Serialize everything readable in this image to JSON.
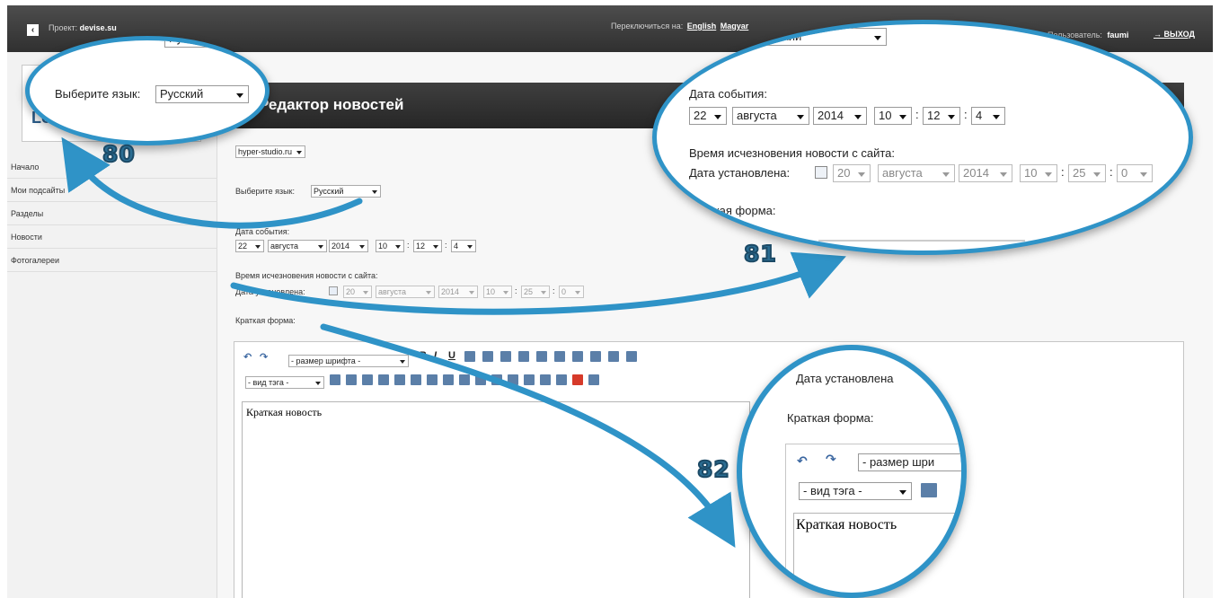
{
  "header": {
    "back_icon": "‹",
    "project_label": "Проект:",
    "project_name": "devise.su",
    "switch_label": "Переключиться на:",
    "lang_en": "English",
    "lang_hu": "Magyar",
    "user_label": "Пользователь:",
    "user_name": "faumi",
    "logout_icon": "→",
    "logout_label": "ВЫХОД"
  },
  "sidebar": {
    "items": [
      {
        "label": "Начало"
      },
      {
        "label": "Мои подсайты"
      },
      {
        "label": "Разделы"
      },
      {
        "label": "Новости"
      },
      {
        "label": "Фотогалереи"
      }
    ]
  },
  "main": {
    "title": "Редактор новостей",
    "site_select": "hyper-studio.ru",
    "language_label": "Выберите язык:",
    "language_value": "Русский",
    "event_date_label": "Дата события:",
    "event_date": {
      "day": "22",
      "month": "августа",
      "year": "2014",
      "hour": "10",
      "minute": "12",
      "second": "4"
    },
    "expire_label": "Время исчезновения новости с сайта:",
    "expire_set_label": "Дата установлена:",
    "expire_date": {
      "day": "20",
      "month": "августа",
      "year": "2014",
      "hour": "10",
      "minute": "25",
      "second": "0"
    },
    "short_form_label": "Краткая форма:",
    "editor": {
      "font_size_placeholder": "- размер шрифта -",
      "tag_type_placeholder": "- вид тэга -",
      "bold": "B",
      "italic": "I",
      "underline": "U",
      "content": "Краткая новость"
    }
  },
  "callouts": {
    "z80": {
      "label": "Выберите язык:",
      "value": "Русский",
      "top_value": "Русский"
    },
    "z81": {
      "top_select": "Русский",
      "event_label": "Дата события:",
      "event_date": {
        "day": "22",
        "month": "августа",
        "year": "2014",
        "hour": "10",
        "minute": "12",
        "second": "4"
      },
      "expire_label": "Время исчезновения новости с сайта:",
      "set_label": "Дата установлена:",
      "expire_date": {
        "day": "20",
        "month": "августа",
        "year": "2014",
        "hour": "10",
        "minute": "25",
        "second": "0"
      },
      "short_form_label": "Краткая форма:"
    },
    "z82": {
      "date_set_label": "Дата установлена",
      "short_form_label": "Краткая форма:",
      "font_size_placeholder": "- размер шри",
      "tag_type_placeholder": "- вид тэга -",
      "content": "Краткая новость"
    },
    "steps": [
      "80",
      "81",
      "82"
    ]
  },
  "colors": {
    "accent": "#2f93c7",
    "header": "#3a3a3a",
    "step_text": "#2a6d93"
  }
}
